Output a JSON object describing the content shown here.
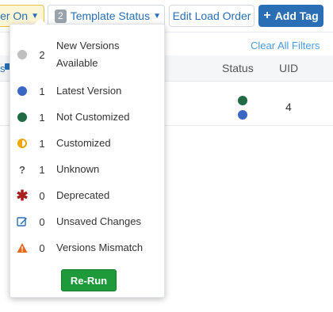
{
  "toolbar": {
    "filter_label": "er On",
    "template_count": "2",
    "template_label": "Template Status",
    "edit_load_order_label": "Edit Load Order",
    "add_tag_label": "Add Tag"
  },
  "filters": {
    "clear_label": "Clear All Filters"
  },
  "table": {
    "headers": {
      "left_fragment": "s",
      "status": "Status",
      "uid": "UID"
    },
    "rows": [
      {
        "status_colors": [
          "#1e6b44",
          "#3a66c4"
        ],
        "uid": "4"
      }
    ]
  },
  "template_panel": {
    "items": [
      {
        "icon": "gray-dot-icon",
        "color": "#bfbfbf",
        "count": "2",
        "label": "New Versions Available"
      },
      {
        "icon": "blue-dot-icon",
        "color": "#3a66c4",
        "count": "1",
        "label": "Latest Version"
      },
      {
        "icon": "green-dot-icon",
        "color": "#1e6b44",
        "count": "1",
        "label": "Not Customized"
      },
      {
        "icon": "half-circle-icon",
        "color": "#f0a500",
        "count": "1",
        "label": "Customized"
      },
      {
        "icon": "question-mark-icon",
        "color": "#555555",
        "count": "1",
        "label": "Unknown"
      },
      {
        "icon": "asterisk-icon",
        "color": "#a81d1d",
        "count": "0",
        "label": "Deprecated"
      },
      {
        "icon": "edit-icon",
        "color": "#2a6fb5",
        "count": "0",
        "label": "Unsaved Changes"
      },
      {
        "icon": "warning-icon",
        "color": "#e8671c",
        "count": "0",
        "label": "Versions Mismatch"
      }
    ],
    "rerun_label": "Re-Run"
  }
}
